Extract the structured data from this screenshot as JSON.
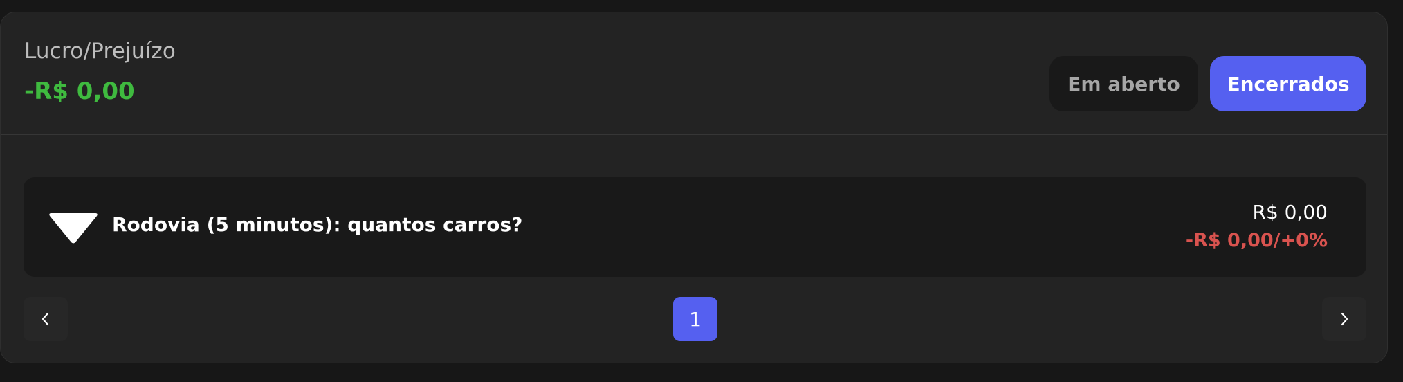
{
  "summary": {
    "label": "Lucro/Prejuízo",
    "value": "-R$ 0,00",
    "value_color": "#3fba3f"
  },
  "filters": {
    "open_label": "Em aberto",
    "closed_label": "Encerrados",
    "active": "Encerrados",
    "accent_color": "#5560f0"
  },
  "positions": [
    {
      "icon": "down-triangle-icon",
      "title": "Rodovia (5 minutos): quantos carros?",
      "amount": "R$ 0,00",
      "pnl": "-R$ 0,00/+0%",
      "pnl_color": "#d9534f"
    }
  ],
  "pagination": {
    "current_page": "1",
    "prev_icon": "chevron-left-icon",
    "next_icon": "chevron-right-icon"
  }
}
